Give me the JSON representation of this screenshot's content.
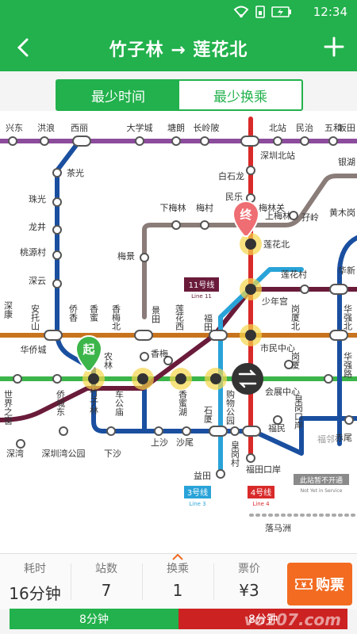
{
  "status": {
    "time": "12:34"
  },
  "header": {
    "title": "竹子林 → 莲花北"
  },
  "tabs": [
    {
      "label": "最少时间"
    },
    {
      "label": "最少换乘"
    }
  ],
  "map": {
    "stations": {
      "s1": "兴东",
      "s2": "洪浪",
      "s3": "西丽",
      "s4": "大学城",
      "s5": "塘朗",
      "s6": "长岭陂",
      "s7": "北站",
      "s8": "民治",
      "s9": "五和",
      "s10": "坂田",
      "s11": "深圳北站",
      "s12": "白石龙",
      "s13": "民乐",
      "s14": "梅林关",
      "s15": "银湖",
      "s16": "茶光",
      "s17": "珠光",
      "s18": "龙井",
      "s19": "桃源村",
      "s20": "深云",
      "s21": "下梅林",
      "s22": "梅村",
      "s23": "上梅林",
      "s24": "孖岭",
      "s25": "黄木岗",
      "s26": "梅景",
      "s27": "莲花北",
      "s28": "莲花村",
      "s29": "华新",
      "s30": "深康",
      "s31": "安托山",
      "s32": "侨香",
      "s33": "香蜜",
      "s34": "香梅北",
      "s35": "景田",
      "s36": "莲花西",
      "s37": "福田",
      "s38": "少年宫",
      "s39": "岗厦北",
      "s40": "华强北",
      "s41": "华侨城",
      "s42": "车公庙",
      "s43": "农林",
      "s44": "香梅",
      "s45": "市民中心",
      "s46": "岗厦",
      "s47": "华强路",
      "s48": "世界之窗",
      "s49": "侨城东",
      "s50": "竹子林",
      "s51": "东公庙",
      "s52": "香蜜湖",
      "s53": "购物公园",
      "s54": "会展中心",
      "s55": "科学馆",
      "s56": "石厦",
      "s57": "福民",
      "s58": "皇岗口岸",
      "s59": "赤尾",
      "s60": "深湾",
      "s61": "深圳湾公园",
      "s62": "下沙",
      "s63": "上沙",
      "s64": "沙尾",
      "s65": "皇岗村",
      "s66": "福邻",
      "s67": "益田",
      "s68": "福田口岸",
      "s69": "落马洲"
    },
    "lines": {
      "line3": "3号线",
      "line3en": "Line 3",
      "line4": "4号线",
      "line4en": "Line 4",
      "line11": "11号线",
      "line11en": "Line 11"
    },
    "markers": {
      "start": "起",
      "end": "终"
    },
    "notice": "此站暂不开通",
    "notice_en": "Not Yet in Service"
  },
  "stats": [
    {
      "label": "耗时",
      "value": "16分钟"
    },
    {
      "label": "站数",
      "value": "7"
    },
    {
      "label": "换乘",
      "value": "1"
    },
    {
      "label": "票价",
      "value": "¥3"
    }
  ],
  "buy_label": "购票",
  "segments": [
    {
      "label": "8分钟"
    },
    {
      "label": "8分钟"
    }
  ],
  "watermark": "vo107.com",
  "colors": {
    "primary": "#22b14c",
    "accent": "#f26b21",
    "line1": "#3cb54a",
    "line2": "#c8741e",
    "line3": "#29a3d8",
    "line4": "#d92a2a",
    "line5": "#8c4c9c",
    "line7": "#1a4fa0",
    "line9": "#8a7c78",
    "line11": "#6a1b3a"
  }
}
